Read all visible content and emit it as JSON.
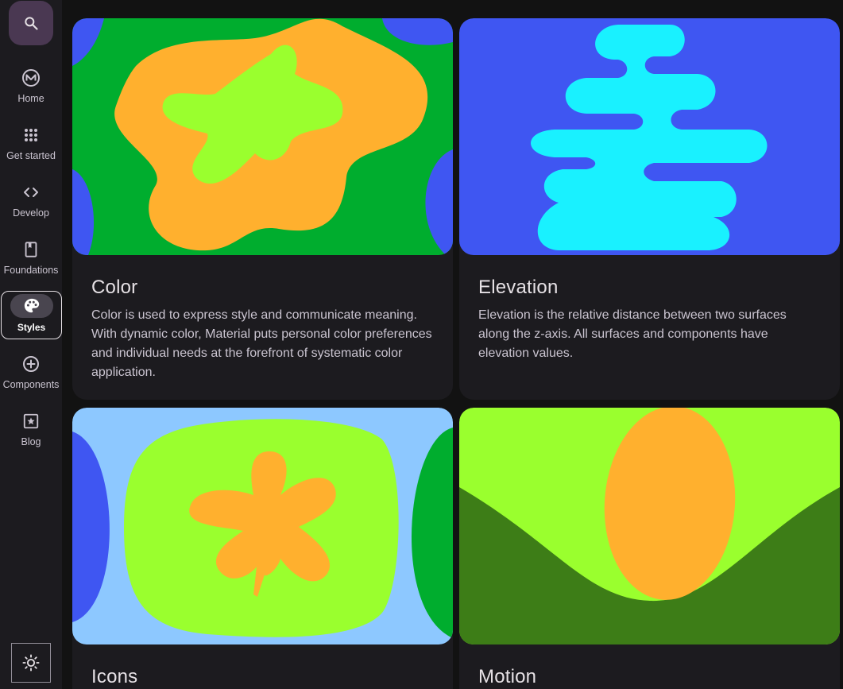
{
  "nav": {
    "search_icon": "search-icon",
    "items": [
      {
        "label": "Home",
        "icon": "material-logo-icon"
      },
      {
        "label": "Get started",
        "icon": "apps-grid-icon"
      },
      {
        "label": "Develop",
        "icon": "code-icon"
      },
      {
        "label": "Foundations",
        "icon": "book-icon"
      },
      {
        "label": "Styles",
        "icon": "palette-icon",
        "active": true
      },
      {
        "label": "Components",
        "icon": "add-circle-icon"
      },
      {
        "label": "Blog",
        "icon": "star-square-icon"
      }
    ],
    "theme_icon": "brightness-icon"
  },
  "cards": [
    {
      "title": "Color",
      "description": "Color is used to express style and communicate meaning. With dynamic color, Material puts personal color preferences and individual needs at the forefront of systematic color application."
    },
    {
      "title": "Elevation",
      "description": "Elevation is the relative distance between two surfaces along the z-axis. All surfaces and components have elevation values."
    },
    {
      "title": "Icons",
      "description": ""
    },
    {
      "title": "Motion",
      "description": ""
    }
  ],
  "colors": {
    "blue": "#3f56f2",
    "cyan": "#19f1ff",
    "green": "#00ad2e",
    "lime": "#9aff2e",
    "orange": "#ffb02e",
    "light_blue": "#8dc8ff",
    "dark_green": "#3d7d17"
  }
}
